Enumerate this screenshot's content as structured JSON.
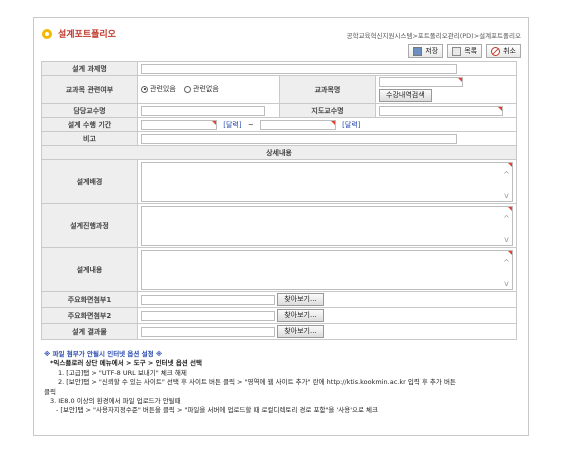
{
  "header": {
    "title": "설계포트폴리오",
    "breadcrumb": "공학교육혁신지원시스템>포트폴리오관리(PD)>설계포트폴리오"
  },
  "toolbar": {
    "save_label": "저장",
    "list_label": "목록",
    "cancel_label": "취소"
  },
  "form": {
    "task_name_label": "설계 과제명",
    "course_related_label": "교과목 관련여부",
    "radio_related": "관련있음",
    "radio_unrelated": "관련없음",
    "course_name_label": "교과목명",
    "course_search_button": "수강내역검색",
    "professor_label": "담당교수명",
    "advisor_label": "지도교수명",
    "period_label": "설계 수행 기간",
    "calendar_link": "[달력]",
    "period_sep": "~",
    "note_label": "비고",
    "detail_section": "상세내용",
    "background_label": "설계배경",
    "process_label": "설계진행과정",
    "content_label": "설계내용",
    "attach1_label": "주요화면첨부1",
    "attach2_label": "주요화면첨부2",
    "result_label": "설계 결과물",
    "browse_button": "찾아보기..."
  },
  "notes": {
    "title": "※ 파일 첨부가 안될시 인터넷 옵션 설정 ※",
    "subtitle": "*익스플로러 상단 메뉴에서 > 도구 > 인터넷 옵션 선택",
    "line1": "1. [고급]탭 > \"UTF-8 URL 보내기\" 체크 해제",
    "line2": "2. [보안]탭 > \"신뢰할 수 있는 사이트\" 선택 후 사이트 버튼 클릭 > \"영역에 웹 사이트 추가\" 란에 http://ktis.kookmin.ac.kr 입력 후 추가 버튼",
    "line2b": "클릭",
    "line3": "3. IE8.0 이상의 환경에서 파일 업로드가 안될때",
    "line4": "- [보안]탭 > \"사용자지정수준\" 버튼을 클릭 > \"파일을 서버에 업로드할 때 로컬디렉토리 경로 포함\"을 '사용'으로 체크"
  },
  "colors": {
    "title_red": "#c0392b",
    "title_icon": "#f2b900",
    "link_blue": "#2a4bb0",
    "label_bg": "#eeeeee",
    "required_mark": "#dd4433"
  }
}
